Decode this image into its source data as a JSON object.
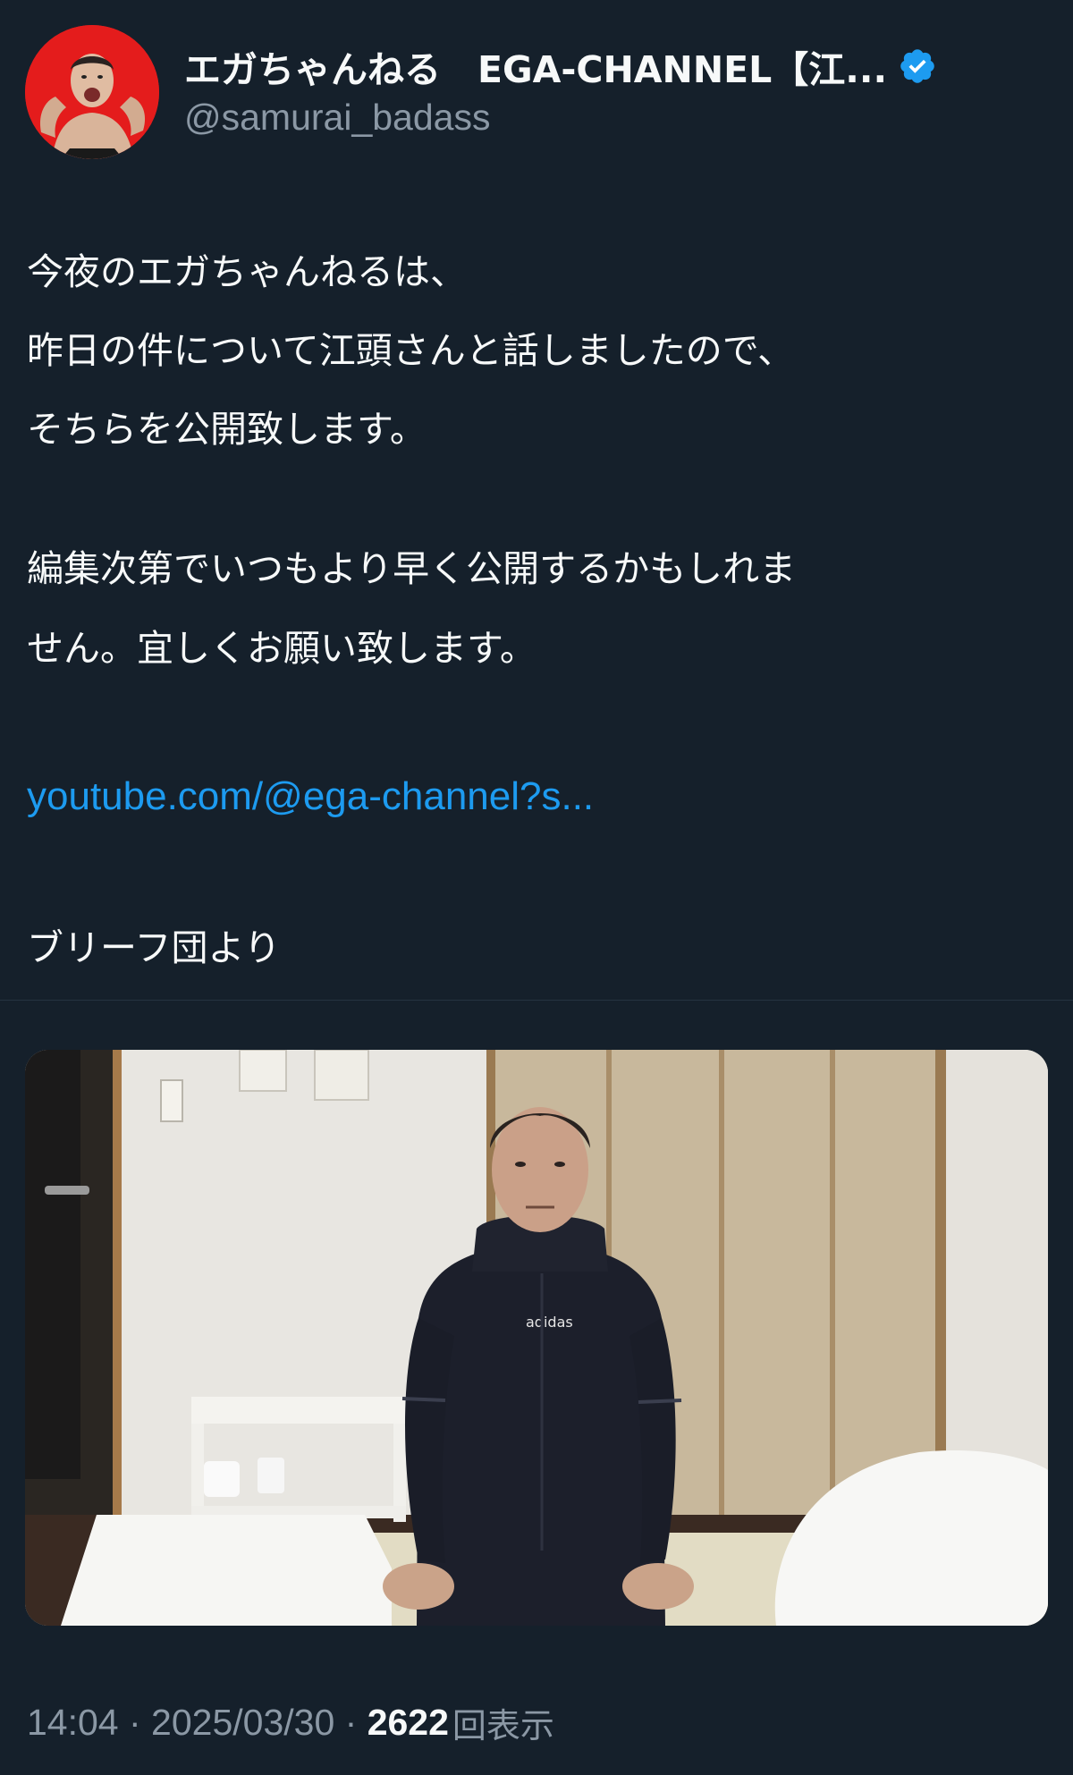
{
  "author": {
    "display_name": "エガちゃんねる　EGA-CHANNEL【江...",
    "handle": "@samurai_badass",
    "verified_icon": "verified-badge-icon",
    "avatar": "profile-photo"
  },
  "tweet": {
    "lines": [
      "今夜のエガちゃんねるは、",
      "昨日の件について江頭さんと話しましたので、",
      "そちらを公開致します。",
      "編集次第でいつもより早く公開するかもしれま",
      "せん。宜しくお願い致します。"
    ],
    "link": "youtube.com/@ega-channel?s...",
    "signature": "ブリーフ団より"
  },
  "media": {
    "description": "photo-man-kneeling"
  },
  "meta": {
    "time": "14:04",
    "separator": " · ",
    "date": "2025/03/30",
    "views_count": "2622",
    "views_label": "回表示"
  },
  "colors": {
    "background": "#15202b",
    "text": "#f7f9f9",
    "secondary": "#8b98a5",
    "link": "#1d9bf0",
    "verified": "#1d9bf0"
  }
}
